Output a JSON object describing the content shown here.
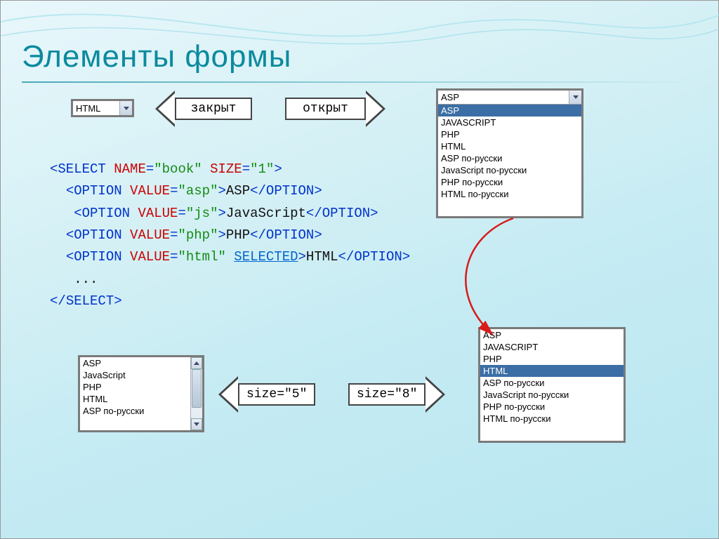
{
  "title": "Элементы формы",
  "arrows": {
    "closed_label": "закрыт",
    "open_label": "открыт",
    "size5_label": "size=\"5\"",
    "size8_label": "size=\"8\""
  },
  "dropdown_closed_value": "HTML",
  "listbox_open": {
    "header_value": "ASP",
    "options": [
      "ASP",
      "JAVASCRIPT",
      "PHP",
      "HTML",
      "ASP по-русски",
      "JavaScript по-русски",
      "PHP по-русски",
      "HTML по-русски"
    ],
    "selected_index": 0
  },
  "listbox_size5": {
    "options_visible": [
      "ASP",
      "JavaScript",
      "PHP",
      "HTML",
      "ASP по-русски"
    ]
  },
  "listbox_size8": {
    "options": [
      "ASP",
      "JAVASCRIPT",
      "PHP",
      "HTML",
      "ASP по-русски",
      "JavaScript по-русски",
      "PHP по-русски",
      "HTML по-русски"
    ],
    "selected_index": 3
  },
  "code": {
    "line1": {
      "tag_open": "select",
      "attr1_name": "name",
      "attr1_val": "\"book\"",
      "attr2_name": "size",
      "attr2_val": "\"1\""
    },
    "line2": {
      "tag": "option",
      "attr_name": "value",
      "attr_val": "\"asp\"",
      "text": "ASP"
    },
    "line3": {
      "tag": "option",
      "attr_name": "value",
      "attr_val": "\"js\"",
      "text": "JavaScript"
    },
    "line4": {
      "tag": "option",
      "attr_name": "value",
      "attr_val": "\"php\"",
      "text": "PHP"
    },
    "line5": {
      "tag": "option",
      "attr_name": "value",
      "attr_val": "\"html\"",
      "selected": "selected",
      "text": "HTML"
    },
    "ellipsis": "...",
    "close_tag": "select"
  }
}
